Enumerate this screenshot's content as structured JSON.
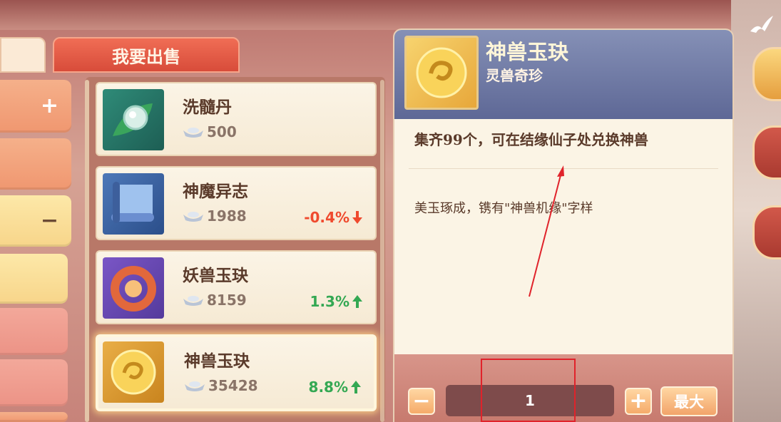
{
  "tabs": {
    "sell_label": "我要出售"
  },
  "categories": [
    {
      "sign": "+"
    },
    {
      "sign": ""
    },
    {
      "sign": "−"
    },
    {
      "sign": ""
    },
    {
      "sign": ""
    },
    {
      "sign": ""
    }
  ],
  "items": [
    {
      "name": "洗髓丹",
      "price": "500",
      "change": "",
      "direction": "none",
      "icon": "pearl-leaf-icon"
    },
    {
      "name": "神魔异志",
      "price": "1988",
      "change": "-0.4%",
      "direction": "down",
      "icon": "scroll-icon"
    },
    {
      "name": "妖兽玉玦",
      "price": "8159",
      "change": "1.3%",
      "direction": "up",
      "icon": "red-jade-pendant-icon"
    },
    {
      "name": "神兽玉玦",
      "price": "35428",
      "change": "8.8%",
      "direction": "up",
      "icon": "gold-jade-pendant-icon",
      "selected": true
    }
  ],
  "detail": {
    "name": "神兽玉玦",
    "category": "灵兽奇珍",
    "line1": "集齐99个，可在结缘仙子处兑换神兽",
    "line2": "美玉琢成，镌有\"神兽机缘\"字样",
    "icon": "gold-jade-pendant-icon"
  },
  "quantity": {
    "minus_label": "−",
    "value": "1",
    "plus_label": "+",
    "max_label": "最大"
  },
  "colors": {
    "accent": "#f06d55",
    "up": "#34a853",
    "down": "#ef4a2e",
    "annotation": "#e0232b"
  }
}
